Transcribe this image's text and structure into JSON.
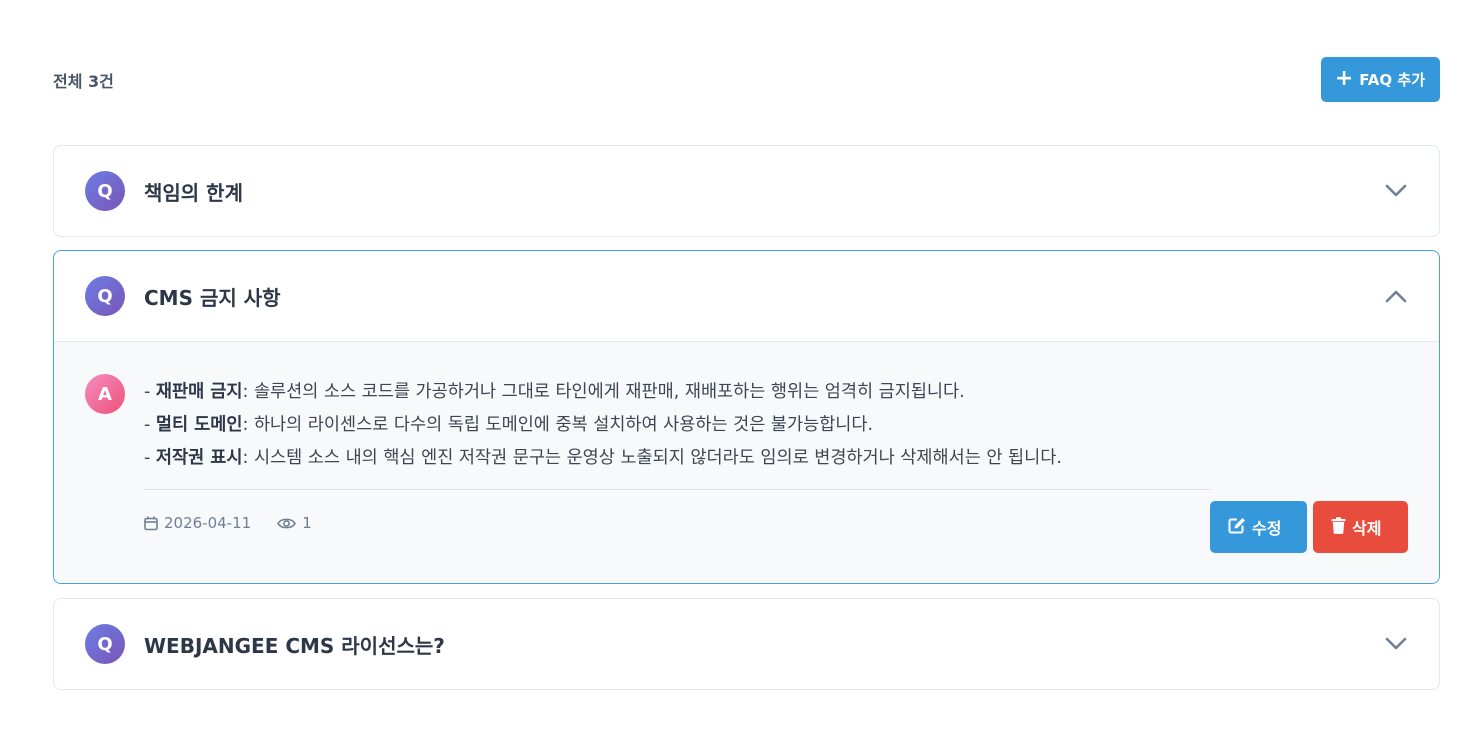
{
  "header": {
    "total_label": "전체 3건",
    "add_button_label": "FAQ 추가"
  },
  "faqs": [
    {
      "q_badge": "Q",
      "title": "책임의 한계",
      "state": "collapsed"
    },
    {
      "q_badge": "Q",
      "title": "CMS 금지 사항",
      "state": "expanded",
      "a_badge": "A",
      "answer_lines": [
        {
          "prefix": "- ",
          "bold": "재판매 금지",
          "text": ": 솔루션의 소스 코드를 가공하거나 그대로 타인에게 재판매, 재배포하는 행위는 엄격히 금지됩니다."
        },
        {
          "prefix": "- ",
          "bold": "멀티 도메인",
          "text": ": 하나의 라이센스로 다수의 독립 도메인에 중복 설치하여 사용하는 것은 불가능합니다."
        },
        {
          "prefix": "- ",
          "bold": "저작권 표시",
          "text": ": 시스템 소스 내의 핵심 엔진 저작권 문구는 운영상 노출되지 않더라도 임의로 변경하거나 삭제해서는 안 됩니다."
        }
      ],
      "date": "2026-04-11",
      "views": "1",
      "edit_label": "수정",
      "delete_label": "삭제"
    },
    {
      "q_badge": "Q",
      "title": "WEBJANGEE CMS 라이선스는?",
      "state": "collapsed"
    }
  ],
  "colors": {
    "primary": "#3498db",
    "danger": "#e74c3c",
    "q_gradient": [
      "#6a7ee6",
      "#7b55b5"
    ],
    "a_gradient": [
      "#f48fc2",
      "#ef4f78"
    ]
  },
  "icons": {
    "add": "plus-icon",
    "collapsed": "chevron-down-icon",
    "expanded": "chevron-up-icon",
    "date": "calendar-icon",
    "views": "eye-icon",
    "edit": "edit-icon",
    "delete": "trash-icon"
  }
}
